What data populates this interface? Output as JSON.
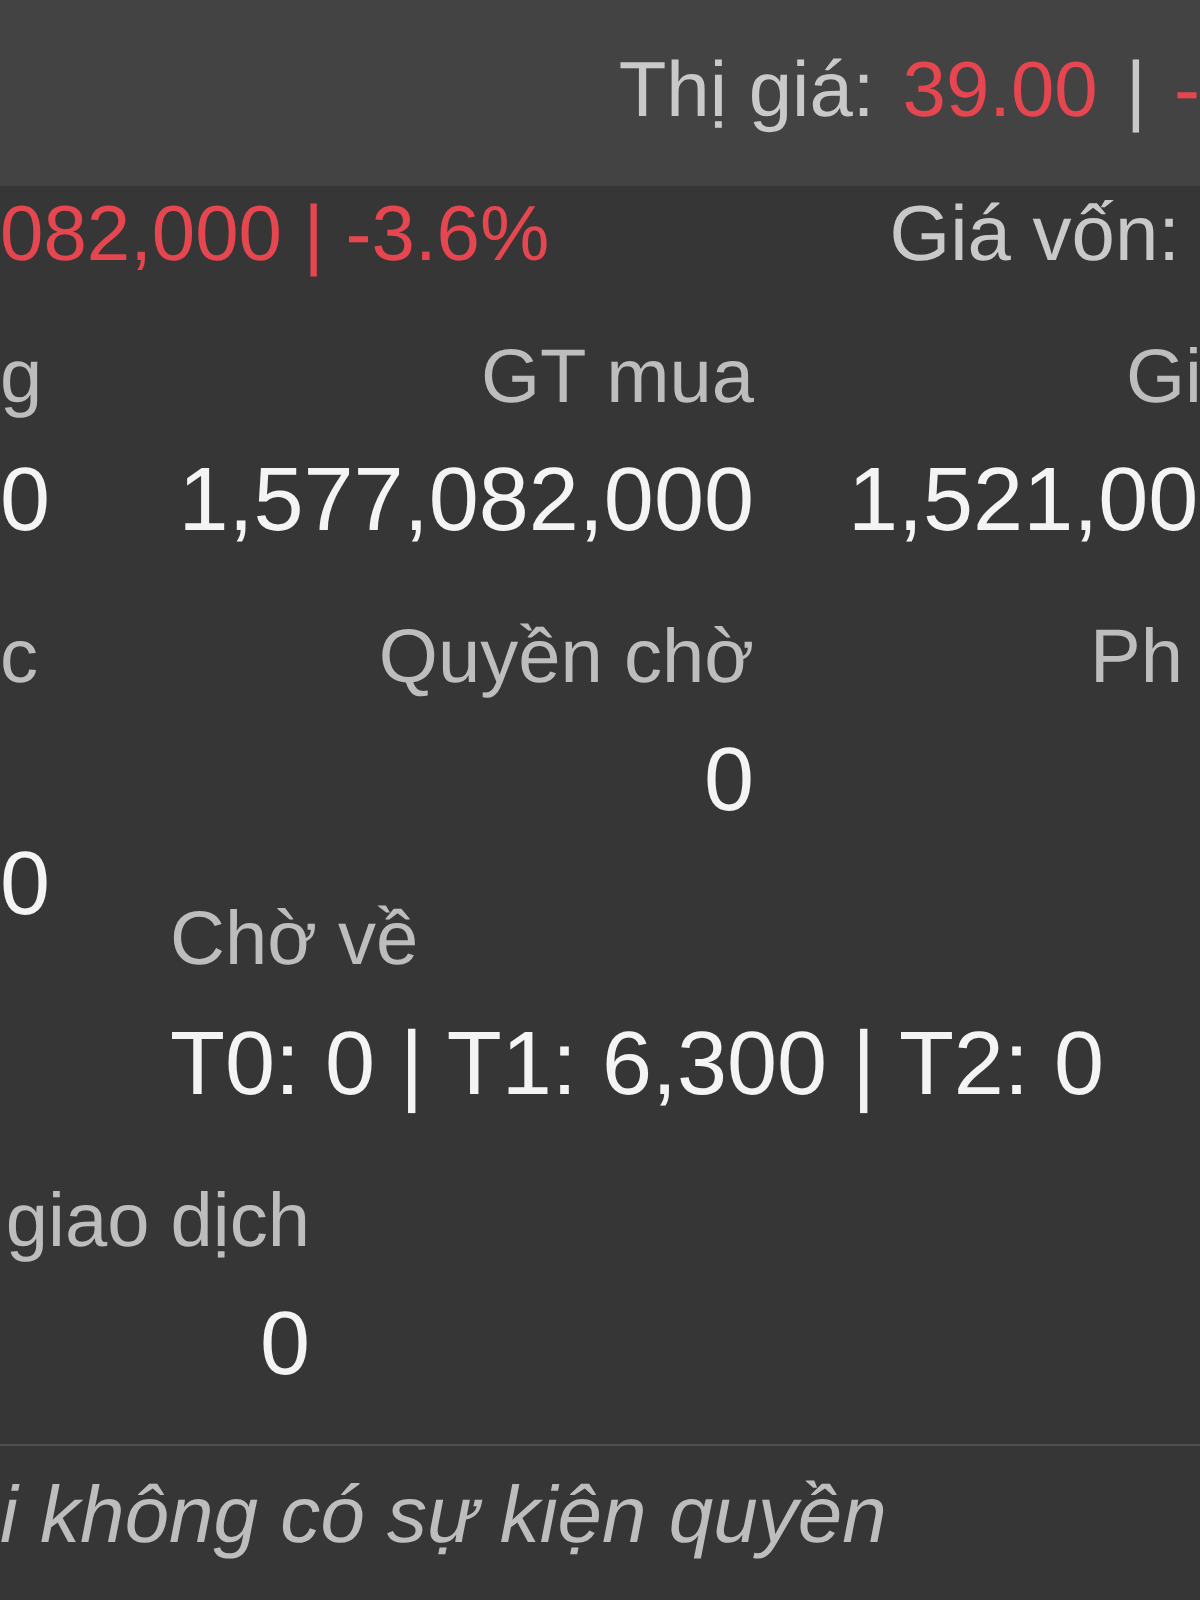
{
  "header": {
    "label": "Thị giá:",
    "value": "39.00",
    "separator": "|",
    "change": "-",
    "negative": true
  },
  "summary": {
    "profit_loss": "082,000 | -3.6%",
    "negative": true,
    "cost_price_label": "Giá vốn:"
  },
  "value_grid": [
    {
      "label": "g",
      "value": "0"
    },
    {
      "label": "GT mua",
      "value": "1,577,082,000"
    },
    {
      "label": "Gi",
      "value": "1,521,00"
    }
  ],
  "rights_grid": [
    {
      "label": "c",
      "value": "0"
    },
    {
      "label": "Quyền chờ",
      "value": "0"
    },
    {
      "label": "Ph"
    }
  ],
  "pending_return": {
    "label": "Chờ về",
    "value": "T0: 0 | T1: 6,300 | T2: 0"
  },
  "trading": {
    "label": "giao dịch",
    "value": "0"
  },
  "footer_note": "i không có sự kiện quyền"
}
